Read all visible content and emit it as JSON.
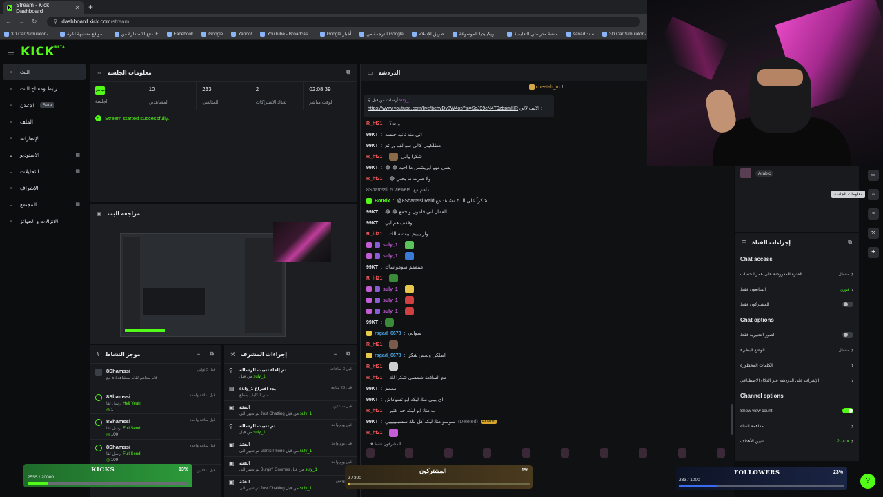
{
  "browser": {
    "tab_title": "Stream - Kick Dashboard",
    "url_host": "dashboard.kick.com",
    "url_path": "/stream",
    "bookmarks": [
      "3D Car Simulator -...",
      "مواقع مشابهة لكرة...",
      "دفع الاستدارة من IE",
      "Facebook",
      "Google",
      "Yahoo!",
      "YouTube - Broadcas...",
      "Google أخبار",
      "الترجمة من Google",
      "طريق الإسلام",
      "ويكيبيديا الموسوعة ...",
      "منصة مدرستي التعليمية",
      "sanad:سند",
      "3D Car Simulator -..."
    ]
  },
  "app": {
    "logo": "KICK",
    "logo_tag": "BETA"
  },
  "sidebar": {
    "items": [
      {
        "label": "البث",
        "icon": "live-icon",
        "active": true
      },
      {
        "label": "رابط ومفتاح البث",
        "icon": "link-icon"
      },
      {
        "label": "الإعلان",
        "icon": "ad-icon",
        "badge": "Beta"
      },
      {
        "label": "الملف",
        "icon": "profile-icon"
      },
      {
        "label": "الإنجازات",
        "icon": "achievement-icon"
      },
      {
        "label": "الاستوديو",
        "icon": "studio-icon",
        "expand": true
      },
      {
        "label": "التحليلات",
        "icon": "analytics-icon",
        "expand": true
      },
      {
        "label": "الإشراف",
        "icon": "moderation-icon"
      },
      {
        "label": "المجتمع",
        "icon": "community-icon",
        "expand": true
      },
      {
        "label": "الإنزالات و الجوائز",
        "icon": "drops-icon"
      }
    ]
  },
  "session": {
    "title": "معلومات الجلسة",
    "live_chip": "مباشر",
    "stats": [
      {
        "value": "",
        "label": "الجلسة"
      },
      {
        "value": "10",
        "label": "المشاهدين"
      },
      {
        "value": "233",
        "label": "المتابعين"
      },
      {
        "value": "2",
        "label": "تعداد الاشتراكات"
      },
      {
        "value": "02:08:39",
        "label": "الوقت مباشر"
      }
    ],
    "success": "Stream started successfully."
  },
  "preview": {
    "title": "مراجعة البث"
  },
  "activity": {
    "title": "موجز النشاط",
    "items": [
      {
        "name": "8Shamssi",
        "sub": "قام مداهم لقام بمشاهدة 5 مع",
        "hl": "",
        "time": "قبل 5 ثواني",
        "amt": "",
        "gift": true
      },
      {
        "name": "8Shamssi",
        "sub": "أرسل لقا",
        "hl": "Hell Yeah",
        "time": "قبل ساعة واحدة",
        "amt": "1"
      },
      {
        "name": "8Shamssi",
        "sub": "أرسل لقا",
        "hl": "Full Send",
        "time": "قبل ساعة واحدة",
        "amt": "100"
      },
      {
        "name": "8Shamssi",
        "sub": "أرسل لقا",
        "hl": "Full Send",
        "time": "قبل ساعة واحدة",
        "amt": "100"
      },
      {
        "name": "Bateman_0",
        "sub": "",
        "hl": "",
        "time": "قبل ساعتين",
        "amt": ""
      }
    ]
  },
  "modactions": {
    "title": "إجراءات المشرف",
    "items": [
      {
        "t": "تم إلغاء تثبيت الرسالة",
        "s": "من قبل",
        "hl": "suly_1",
        "time": "قبل 3 ساعات",
        "icon": "unpin-icon"
      },
      {
        "t": "suly_1 بدء اقتراع",
        "s": "متى الكايف يقطع",
        "hl": "",
        "time": "قبل 23 ساعة",
        "icon": "poll-icon"
      },
      {
        "t": "الفئة",
        "s": "تم تغيير الى Just Chatting من قبل",
        "hl": "suly_1",
        "time": "قبل ساعتين",
        "icon": "category-icon"
      },
      {
        "t": "تم تثبيت الرسالة",
        "s": "من قبل",
        "hl": "suly_1",
        "time": "قبل يوم واحد",
        "icon": "pin-icon"
      },
      {
        "t": "الفئة",
        "s": "تم تغيير الى Gartic Phone من قبل",
        "hl": "suly_1",
        "time": "قبل يوم واحد",
        "icon": "category-icon"
      },
      {
        "t": "الفئة",
        "s": "تم تغيير الى Burgin' Gnomes من قبل",
        "hl": "suly_1",
        "time": "قبل يوم واحد",
        "icon": "category-icon"
      },
      {
        "t": "الفئة",
        "s": "تم تغيير الى Just Chatting من قبل",
        "hl": "suly_1",
        "time": "قبل يومين",
        "icon": "category-icon"
      }
    ]
  },
  "chat": {
    "title": "الدردشة",
    "pinned_by": "cheetah_m",
    "pinned_count": "1",
    "pinned_user": "suly_1",
    "pinned_note": "أرسلت من قبل",
    "pinned_label": "الايف لالي :",
    "pinned_link": "https://www.youtube.com/live/behyDy8W4os?si=ScJ99cN4T9zbpmHR",
    "lines": [
      {
        "u": "R_hf21",
        "c": "#f05a5a",
        "t": "وات؟"
      },
      {
        "u": "99KT",
        "c": "#e6e9ec",
        "t": "انى منه ثانيه جلسه"
      },
      {
        "u": "99KT",
        "c": "#e6e9ec",
        "t": "مطلكيني كالي سوالف ورائم"
      },
      {
        "u": "R_hf21",
        "c": "#f05a5a",
        "t": "شكرا وابي",
        "emote": "#8b6a4a"
      },
      {
        "u": "99KT",
        "c": "#e6e9ec",
        "t": "😂 😂 يسي موو ابريشس ما احبه"
      },
      {
        "u": "R_hf21",
        "c": "#f05a5a",
        "t": "😂 ولا صرت ما يحبي"
      },
      {
        "u": "8Shamssi",
        "c": "#9aa0a6",
        "t": "5 viewers. داهم مع",
        "system": true
      },
      {
        "u": "BotRix",
        "c": "#53fc18",
        "t": "@8Shamssi Raid شكراً على الـ 5 مشاهد مع",
        "badge": "g"
      },
      {
        "u": "99KT",
        "c": "#e6e9ec",
        "t": "😂 😂 العقال اني قاعون واجمع"
      },
      {
        "u": "99KT",
        "c": "#e6e9ec",
        "t": "وقفف هم ايي"
      },
      {
        "u": "R_hf21",
        "c": "#f05a5a",
        "t": "وار ييييم بيبت منالك"
      },
      {
        "u": "suly_1",
        "c": "#c45cd8",
        "t": "",
        "emote": "#5ac35a",
        "badge": "p"
      },
      {
        "u": "suly_1",
        "c": "#c45cd8",
        "t": "",
        "emote": "#3b7bd8",
        "badge": "p"
      },
      {
        "u": "99KT",
        "c": "#e6e9ec",
        "t": "ممممم سومو ساك"
      },
      {
        "u": "R_hf21",
        "c": "#f05a5a",
        "t": "",
        "emote": "#3a8a3a"
      },
      {
        "u": "suly_1",
        "c": "#c45cd8",
        "t": "",
        "emote": "#e7c84a",
        "badge": "p"
      },
      {
        "u": "suly_1",
        "c": "#c45cd8",
        "t": "",
        "emote": "#d04040",
        "badge": "p"
      },
      {
        "u": "suly_1",
        "c": "#c45cd8",
        "t": "",
        "emote": "#d04040",
        "badge": "p"
      },
      {
        "u": "99KT",
        "c": "#e6e9ec",
        "t": "",
        "emote": "#3a8a3a"
      },
      {
        "u": "ragad_6678",
        "c": "#4aa3e0",
        "t": "سوالي",
        "badge": "y"
      },
      {
        "u": "R_hf21",
        "c": "#f05a5a",
        "t": "",
        "emote": "#7a5a4a"
      },
      {
        "u": "ragad_6678",
        "c": "#4aa3e0",
        "t": "اطلكن ولعس شكر",
        "badge": "y"
      },
      {
        "u": "R_hf21",
        "c": "#f05a5a",
        "t": "",
        "emote": "#cfcfcf"
      },
      {
        "u": "R_hf21",
        "c": "#f05a5a",
        "t": "مع السلامة شمسي شكرا لك"
      },
      {
        "u": "99KT",
        "c": "#e6e9ec",
        "t": "مممم"
      },
      {
        "u": "99KT",
        "c": "#e6e9ec",
        "t": "اي بيبي مثلا ليكه ابو تسوكاش"
      },
      {
        "u": "R_hf21",
        "c": "#f05a5a",
        "t": "ب مثلا ابو ليكه جدا كثير"
      },
      {
        "u": "99KT",
        "c": "#e6e9ec",
        "t": "سوسو مثلا ليكه كل بنك سسببيييييي",
        "deleted": "(Deleted)",
        "tag": "AI Mod"
      },
      {
        "u": "R_hf21",
        "c": "#f05a5a",
        "t": "",
        "emote": "#c45cd8"
      }
    ],
    "footer_note": "المشرفون فقط"
  },
  "side": {
    "lang": "Arabic",
    "tooltip": "معلومات الجلسة"
  },
  "channel": {
    "title": "إجراءات القناة",
    "chat_access": "Chat access",
    "chat_options": "Chat options",
    "channel_options": "Channel options",
    "access_rows": [
      {
        "l": "الفترة المفروضة على عمر الحساب",
        "v": "معطل"
      },
      {
        "l": "المتابعون فقط",
        "v": "فوري",
        "g": true
      },
      {
        "l": "المشتركون فقط",
        "toggle": false
      }
    ],
    "chat_rows": [
      {
        "l": "الصور التعبيرية فقط",
        "toggle": false
      },
      {
        "l": "الوضع البطيء",
        "v": "معطل"
      },
      {
        "l": "الكلمات المحظورة",
        "v": ""
      },
      {
        "l": "الإشراف على الدردشة عبر الذكاء الاصطناعي",
        "v": ""
      }
    ],
    "channel_rows": [
      {
        "l": "Show view count",
        "toggle": true
      },
      {
        "l": "مداهمة القناة",
        "v": ""
      },
      {
        "l": "تعيين الأهداف",
        "v": "هدف 2",
        "g": true
      }
    ]
  },
  "goals": {
    "kicks": {
      "title": "KICKS",
      "pct": "13%",
      "val": "2555 / 20000",
      "fill": 0.13
    },
    "subs": {
      "title": "المشتركون",
      "pct": "1%",
      "val": "2 / 300",
      "fill": 0.01
    },
    "followers": {
      "title": "FOLLOWERS",
      "pct": "23%",
      "val": "233 / 1000",
      "fill": 0.23
    }
  },
  "colors": {
    "accent": "#53fc18",
    "bg": "#0b0d0f",
    "panel": "#181a1d"
  }
}
